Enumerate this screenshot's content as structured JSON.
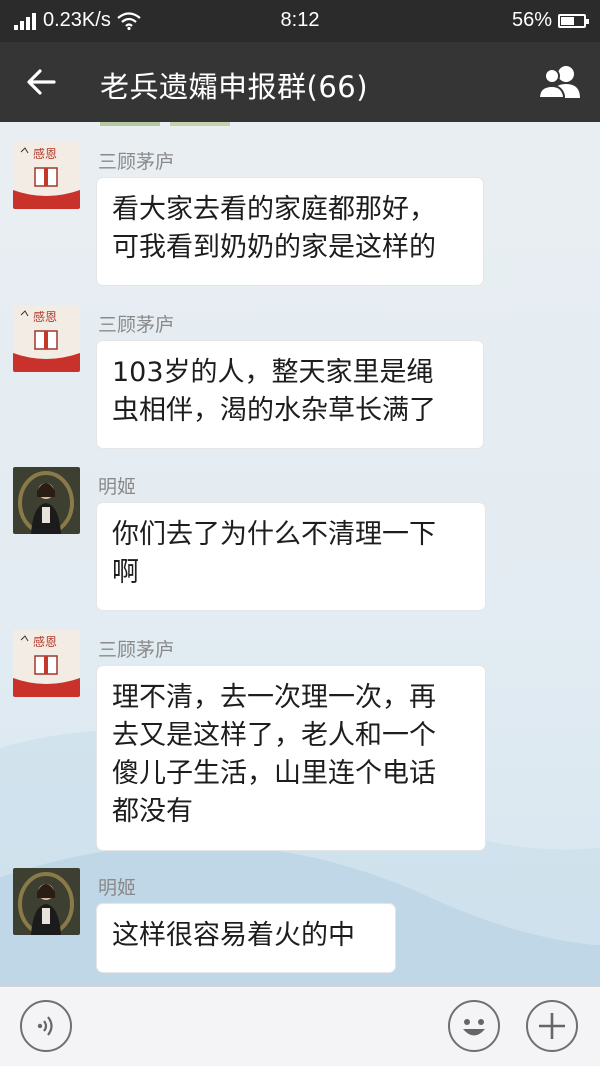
{
  "status_bar": {
    "network_speed": "0.23K/s",
    "time": "8:12",
    "battery_percent": "56%",
    "battery_level": 0.56
  },
  "header": {
    "title": "老兵遗孀申报群(66)",
    "back_icon": "arrow-left-icon",
    "members_icon": "group-members-icon"
  },
  "messages": [
    {
      "sender": "三顾茅庐",
      "text": "看大家去看的家庭都那好，\n可我看到奶奶的家是这样的",
      "avatar_icon": "gratitude-card-avatar",
      "avatar_text": "感恩"
    },
    {
      "sender": "三顾茅庐",
      "text": "103岁的人，整天家里是绳\n虫相伴，渴的水杂草长满了",
      "avatar_icon": "gratitude-card-avatar",
      "avatar_text": "感恩"
    },
    {
      "sender": "明姬",
      "text": "你们去了为什么不清理一下\n啊",
      "avatar_icon": "person-photo-avatar"
    },
    {
      "sender": "三顾茅庐",
      "text": "理不清，去一次理一次，再\n去又是这样了，老人和一个\n傻儿子生活，山里连个电话\n都没有",
      "avatar_icon": "gratitude-card-avatar",
      "avatar_text": "感恩"
    },
    {
      "sender": "明姬",
      "text": "这样很容易着火的中",
      "avatar_icon": "person-photo-avatar"
    }
  ],
  "input_bar": {
    "voice_icon": "voice-input-icon",
    "emoji_icon": "emoji-icon",
    "plus_icon": "plus-icon"
  }
}
